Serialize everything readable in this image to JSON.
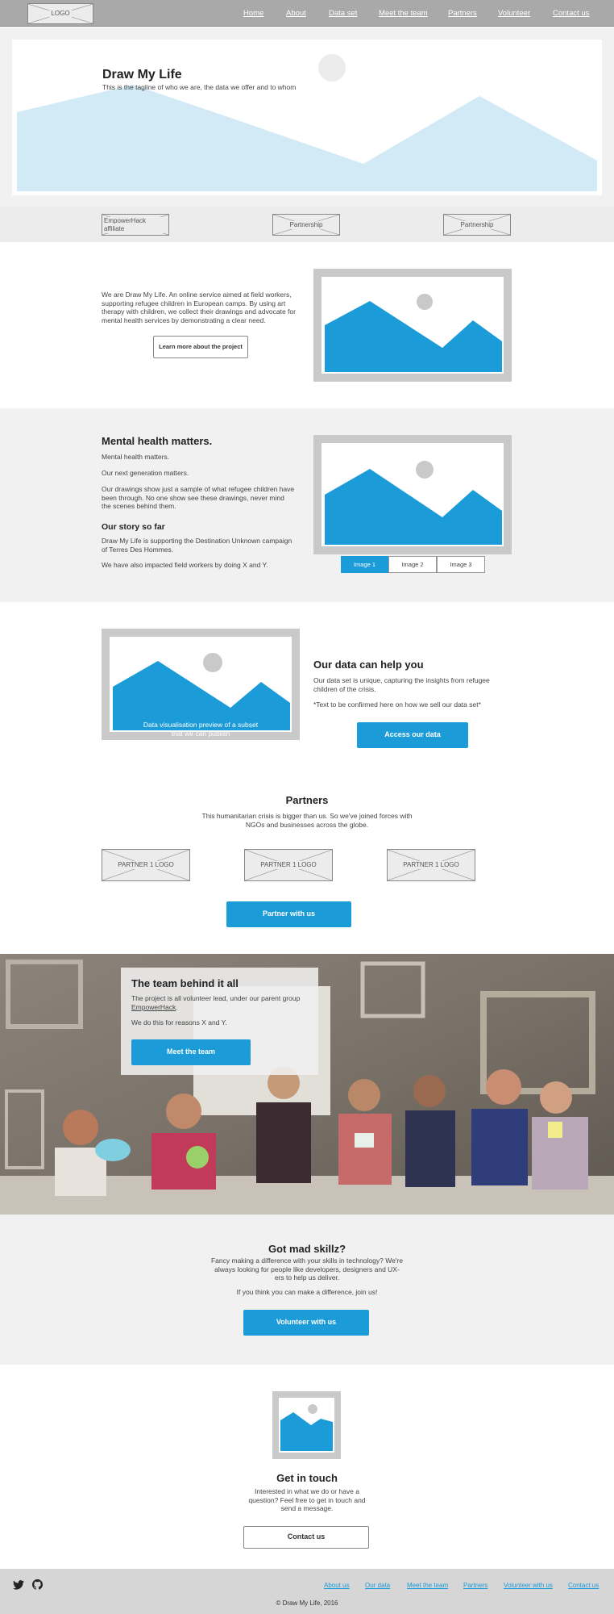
{
  "nav": {
    "logo": "LOGO",
    "links": [
      "Home",
      "About",
      "Data set",
      "Meet the team",
      "Partners",
      "Volunteer",
      "Contact us"
    ]
  },
  "hero": {
    "title": "Draw My Life",
    "tagline": "This is the tagline of who we are, the data we offer and to whom"
  },
  "affiliates": [
    "EmpowerHack affiliate",
    "Partnership",
    "Partnership"
  ],
  "intro": {
    "text": "We are Draw My Life. An online service aimed at field workers, supporting refugee children in European camps. By using art therapy with children, we collect their drawings and advocate for mental health services by demonstrating a clear need.",
    "button": "Learn more about the project"
  },
  "mental": {
    "heading": "Mental health matters.",
    "p1": "Mental health matters.",
    "p2": "Our next generation matters.",
    "p3": "Our drawings show just a sample of what refugee children have been through. No one show see these drawings, never mind the scenes behind them.",
    "story_heading": "Our story so far",
    "p4": "Draw My Life is supporting the Destination Unknown campaign of Terres Des Hommes.",
    "p5": "We have also impacted field workers by doing X and Y.",
    "tabs": [
      "Image 1",
      "Image 2",
      "Image 3"
    ]
  },
  "data": {
    "preview": "Data visualisation preview of a subset that we can publish",
    "heading": "Our data can help you",
    "p1": "Our data set is unique, capturing the insights from refugee children of the crisis.",
    "p2": "*Text to be confirmed here on how we sell our data set*",
    "button": "Access our data"
  },
  "partners": {
    "heading": "Partners",
    "text": "This humanitarian crisis is bigger than us. So we've joined forces with NGOs and businesses across the globe.",
    "logos": [
      "PARTNER 1 LOGO",
      "PARTNER 1 LOGO",
      "PARTNER 1 LOGO"
    ],
    "button": "Partner with us"
  },
  "team": {
    "heading": "The team behind it all",
    "p1": "The project is all volunteer lead, under our parent group",
    "link": "EmpowerHack",
    "p2": "We do this for reasons X and Y.",
    "button": "Meet the team"
  },
  "volunteer": {
    "heading": "Got mad skillz?",
    "p1": "Fancy making a difference with your skills in technology? We're always looking for people like developers, designers and UX-ers to help us deliver.",
    "p2": "If you think you can make a difference, join us!",
    "button": "Volunteer with us"
  },
  "contact": {
    "heading": "Get in touch",
    "text": "Interested in what we do or have a question? Feel free to get in touch and send a message.",
    "button": "Contact us"
  },
  "footer": {
    "links": [
      "About us",
      "Our data",
      "Meet the team",
      "Partners",
      "Volunteer with us",
      "Contact us"
    ],
    "copyright": "© Draw My Life, 2016"
  },
  "colors": {
    "accent": "#1b9bd7",
    "light_blue": "#d2e9f6",
    "gray_bg": "#f1f1f1",
    "nav_bg": "#a9a9a9"
  }
}
